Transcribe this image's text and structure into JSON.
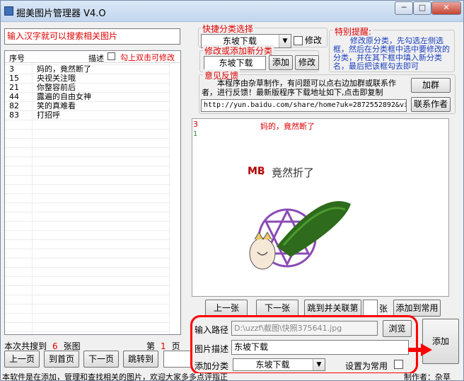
{
  "window": {
    "title": "掘美图片管理器 V4.O",
    "buttons": {
      "minimize": "─",
      "maximize": "□",
      "close": "✕"
    }
  },
  "search": {
    "value": "输入汉字就可以搜索相关图片"
  },
  "list": {
    "col_id": "序号",
    "col_desc": "描述",
    "edit_hint": "勾上双击可修改",
    "rows": [
      {
        "id": "3",
        "desc": "妈的，竟然断了"
      },
      {
        "id": "15",
        "desc": "央视关注哦"
      },
      {
        "id": "21",
        "desc": "你整容前后"
      },
      {
        "id": "44",
        "desc": "露遍的自由女神"
      },
      {
        "id": "82",
        "desc": "笑的真难看"
      },
      {
        "id": "83",
        "desc": "打招呼"
      }
    ]
  },
  "search_result": {
    "prefix": "本次共搜到",
    "count": "6",
    "suffix": "张图"
  },
  "paging": {
    "page_prefix": "第",
    "page": "1",
    "page_suffix": "页",
    "prev": "上一页",
    "first": "到首页",
    "next": "下一页",
    "jump": "跳转到",
    "jump_suffix": "页"
  },
  "quick_category": {
    "legend": "快捷分类选择",
    "selected": "东坡下载",
    "modify": "修改"
  },
  "edit_category": {
    "legend": "修改或添加新分类",
    "value": "东坡下载",
    "add": "添加",
    "modify": "修改"
  },
  "tips": {
    "legend": "特别提醒:",
    "text": "修改原分类，先勾选左侧选框，然后在分类框中选中要修改的分类，并在其下框中填入新分类名，最后把该框勾去即可"
  },
  "feedback": {
    "legend": "意见反馈",
    "text": "本程序由杂草制作，有问题可以点右边加群或联系作者，进行反馈！最新版程序下载地址如下,点击即复制",
    "url": "http://yun.baidu.com/share/home?uk=2872552892&vi",
    "join_group": "加群",
    "contact": "联系作者"
  },
  "preview": {
    "id": "3",
    "desc": "妈的，竟然断了",
    "sub": "1",
    "image_caption": "竟然折了",
    "image_logo": "MB"
  },
  "nav": {
    "prev": "上一张",
    "next": "下一张",
    "jump": "跳到并关联第",
    "unit": "张",
    "add_common": "添加到常用"
  },
  "add_panel": {
    "path_label": "输入路径",
    "path_value": "D:\\uzzf\\截图\\快照375641.jpg",
    "browse": "浏览",
    "desc_label": "图片描述",
    "desc_value": "东坡下载",
    "cat_label": "添加分类",
    "cat_value": "东坡下载",
    "set_common": "设置为常用",
    "add": "添加"
  },
  "status": {
    "left": "本软件是在添加，管理和查找相关的图片，欢迎大家多多点评指正",
    "right": "制作者：杂草"
  },
  "colors": {
    "red": "#e00000",
    "blue": "#1a3fbf",
    "highlight": "#ff0000"
  }
}
